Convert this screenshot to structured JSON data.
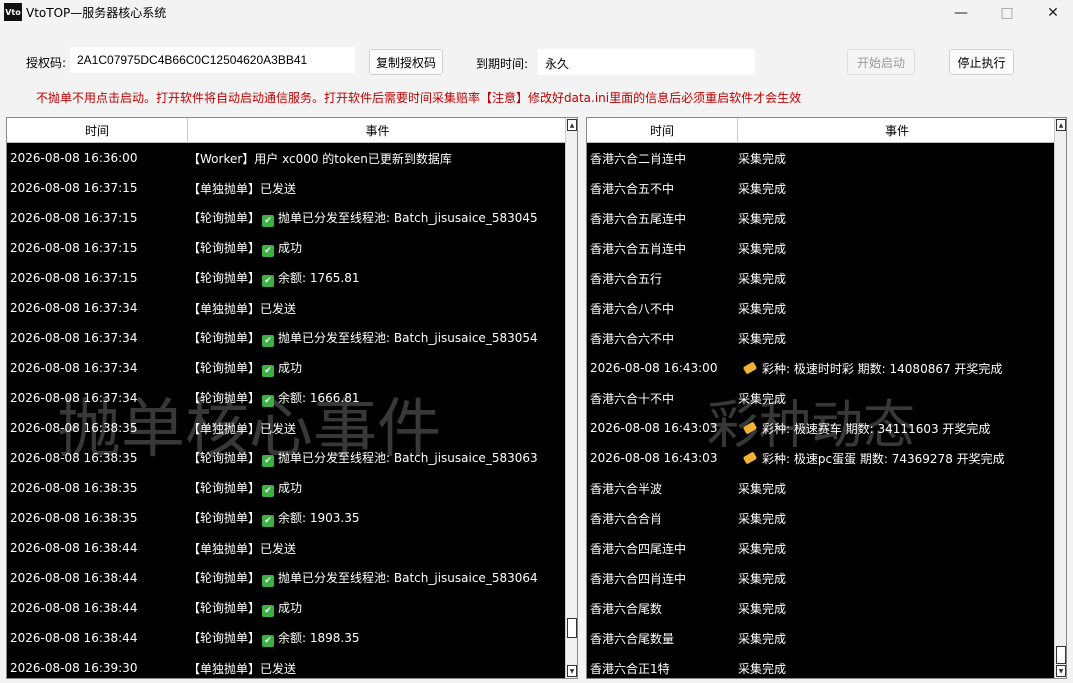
{
  "window": {
    "title": "VtoTOP—服务器核心系统",
    "icon_text": "Vto",
    "minimize_icon": "minimize-icon",
    "maximize_icon": "maximize-icon",
    "close_icon": "close-icon"
  },
  "license": {
    "label": "授权码:",
    "value": "2A1C07975DC4B66C0C12504620A3BB41",
    "copy_button": "复制授权码",
    "expiry_label": "到期时间:",
    "expiry_value": "永久",
    "start_button": "开始启动",
    "stop_button": "停止执行"
  },
  "notice": "不抛单不用点击启动。打开软件将自动启动通信服务。打开软件后需要时间采集赔率【注意】修改好data.ini里面的信息后必须重启软件才会生效",
  "left_panel": {
    "headers": [
      "时间",
      "事件"
    ],
    "watermark": "抛单核心事件",
    "rows": [
      {
        "time": "2026-08-08 16:36:00",
        "event": "【Worker】用户 xc000 的token已更新到数据库",
        "check": false
      },
      {
        "time": "2026-08-08 16:37:15",
        "event": "【单独抛单】已发送",
        "check": false
      },
      {
        "time": "2026-08-08 16:37:15",
        "prefix": "【轮询抛单】",
        "event": "抛单已分发至线程池: Batch_jisusaice_583045",
        "check": true
      },
      {
        "time": "2026-08-08 16:37:15",
        "prefix": "【轮询抛单】",
        "event": "成功",
        "check": true
      },
      {
        "time": "2026-08-08 16:37:15",
        "prefix": "【轮询抛单】",
        "event": "余额: 1765.81",
        "check": true
      },
      {
        "time": "2026-08-08 16:37:34",
        "event": "【单独抛单】已发送",
        "check": false
      },
      {
        "time": "2026-08-08 16:37:34",
        "prefix": "【轮询抛单】",
        "event": "抛单已分发至线程池: Batch_jisusaice_583054",
        "check": true
      },
      {
        "time": "2026-08-08 16:37:34",
        "prefix": "【轮询抛单】",
        "event": "成功",
        "check": true
      },
      {
        "time": "2026-08-08 16:37:34",
        "prefix": "【轮询抛单】",
        "event": "余额: 1666.81",
        "check": true
      },
      {
        "time": "2026-08-08 16:38:35",
        "event": "【单独抛单】已发送",
        "check": false
      },
      {
        "time": "2026-08-08 16:38:35",
        "prefix": "【轮询抛单】",
        "event": "抛单已分发至线程池: Batch_jisusaice_583063",
        "check": true
      },
      {
        "time": "2026-08-08 16:38:35",
        "prefix": "【轮询抛单】",
        "event": "成功",
        "check": true
      },
      {
        "time": "2026-08-08 16:38:35",
        "prefix": "【轮询抛单】",
        "event": "余额: 1903.35",
        "check": true
      },
      {
        "time": "2026-08-08 16:38:44",
        "event": "【单独抛单】已发送",
        "check": false
      },
      {
        "time": "2026-08-08 16:38:44",
        "prefix": "【轮询抛单】",
        "event": "抛单已分发至线程池: Batch_jisusaice_583064",
        "check": true
      },
      {
        "time": "2026-08-08 16:38:44",
        "prefix": "【轮询抛单】",
        "event": "成功",
        "check": true
      },
      {
        "time": "2026-08-08 16:38:44",
        "prefix": "【轮询抛单】",
        "event": "余额: 1898.35",
        "check": true
      },
      {
        "time": "2026-08-08 16:39:30",
        "event": "【单独抛单】已发送",
        "check": false
      }
    ]
  },
  "right_panel": {
    "headers": [
      "时间",
      "事件"
    ],
    "watermark": "彩种动态",
    "rows": [
      {
        "time": "香港六合二肖连中",
        "event": "采集完成",
        "tag": false
      },
      {
        "time": "香港六合五不中",
        "event": "采集完成",
        "tag": false
      },
      {
        "time": "香港六合五尾连中",
        "event": "采集完成",
        "tag": false
      },
      {
        "time": "香港六合五肖连中",
        "event": "采集完成",
        "tag": false
      },
      {
        "time": "香港六合五行",
        "event": "采集完成",
        "tag": false
      },
      {
        "time": "香港六合八不中",
        "event": "采集完成",
        "tag": false
      },
      {
        "time": "香港六合六不中",
        "event": "采集完成",
        "tag": false
      },
      {
        "time": "2026-08-08 16:43:00",
        "event": "彩种:   极速时时彩 期数: 14080867 开奖完成",
        "tag": true
      },
      {
        "time": "香港六合十不中",
        "event": "采集完成",
        "tag": false
      },
      {
        "time": "2026-08-08 16:43:03",
        "event": "彩种:   极速赛车 期数: 34111603 开奖完成",
        "tag": true
      },
      {
        "time": "2026-08-08 16:43:03",
        "event": "彩种:   极速pc蛋蛋 期数: 74369278 开奖完成",
        "tag": true
      },
      {
        "time": "香港六合半波",
        "event": "采集完成",
        "tag": false
      },
      {
        "time": "香港六合合肖",
        "event": "采集完成",
        "tag": false
      },
      {
        "time": "香港六合四尾连中",
        "event": "采集完成",
        "tag": false
      },
      {
        "time": "香港六合四肖连中",
        "event": "采集完成",
        "tag": false
      },
      {
        "time": "香港六合尾数",
        "event": "采集完成",
        "tag": false
      },
      {
        "time": "香港六合尾数量",
        "event": "采集完成",
        "tag": false
      },
      {
        "time": "香港六合正1特",
        "event": "采集完成",
        "tag": false
      }
    ]
  },
  "colors": {
    "notice": "#c00000",
    "panel_bg": "#000000",
    "check": "#3cb043",
    "tag": "#f2b233"
  }
}
